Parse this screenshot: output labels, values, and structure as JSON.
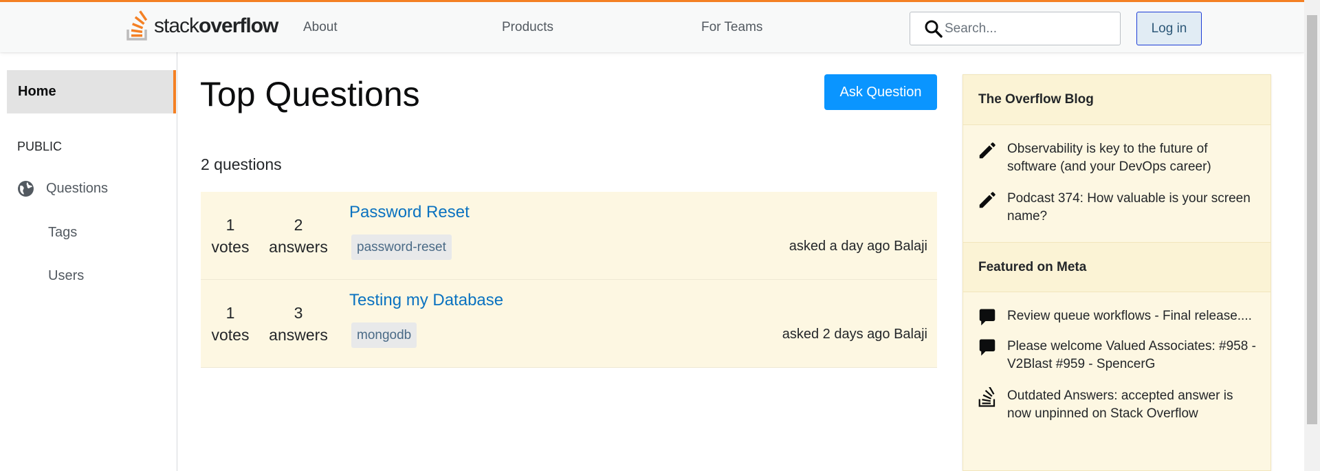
{
  "header": {
    "logo_light": "stack",
    "logo_bold": "overflow",
    "nav": [
      "About",
      "Products",
      "For Teams"
    ],
    "search_placeholder": "Search...",
    "login_label": "Log in"
  },
  "sidebar": {
    "home_label": "Home",
    "section_label": "PUBLIC",
    "items": [
      {
        "label": "Questions",
        "icon": "globe-icon"
      },
      {
        "label": "Tags"
      },
      {
        "label": "Users"
      }
    ]
  },
  "main": {
    "title": "Top Questions",
    "ask_button_label": "Ask Question",
    "count_label": "2 questions",
    "questions": [
      {
        "votes": "1",
        "votes_label": "votes",
        "answers": "2",
        "answers_label": "answers",
        "title": "Password Reset",
        "tag": "password-reset",
        "meta": "asked a day ago Balaji"
      },
      {
        "votes": "1",
        "votes_label": "votes",
        "answers": "3",
        "answers_label": "answers",
        "title": "Testing my Database",
        "tag": "mongodb",
        "meta": "asked 2 days ago Balaji"
      }
    ]
  },
  "widget": {
    "blog_title": "The Overflow Blog",
    "blog_items": [
      {
        "text": "Observability is key to the future of software (and your DevOps career)",
        "icon": "pencil-icon"
      },
      {
        "text": "Podcast 374: How valuable is your screen name?",
        "icon": "pencil-icon"
      }
    ],
    "meta_title": "Featured on Meta",
    "meta_items": [
      {
        "text": "Review queue workflows - Final release....",
        "icon": "speech-bubble-icon"
      },
      {
        "text": "Please welcome Valued Associates: #958 - V2Blast #959 - SpencerG",
        "icon": "speech-bubble-icon"
      },
      {
        "text": "Outdated Answers: accepted answer is now unpinned on Stack Overflow",
        "icon": "stack-overflow-icon"
      }
    ]
  },
  "colors": {
    "accent": "#f48024",
    "link": "#0a72c0",
    "primary_button": "#0a95ff",
    "question_bg": "#fdf7e2"
  }
}
